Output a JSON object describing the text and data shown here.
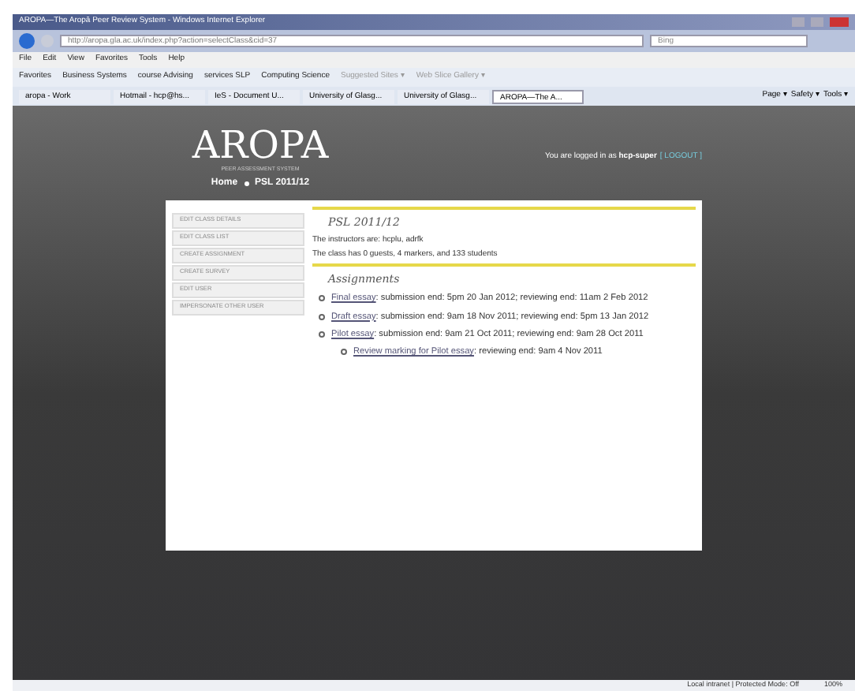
{
  "window": {
    "title": "AROPA—The Aropā Peer Review System - Windows Internet Explorer"
  },
  "address_bar": {
    "url": "http://aropa.gla.ac.uk/index.php?action=selectClass&cid=37",
    "search_placeholder": "Bing"
  },
  "menu": [
    "File",
    "Edit",
    "View",
    "Favorites",
    "Tools",
    "Help"
  ],
  "favorites_bar": [
    "Favorites",
    "Business Systems",
    "course Advising",
    "services SLP",
    "Computing Science",
    "Suggested Sites ▾",
    "Web Slice Gallery ▾"
  ],
  "tabs": [
    {
      "label": "aropa - Work",
      "selected": false
    },
    {
      "label": "Hotmail - hcp@hs...",
      "selected": false
    },
    {
      "label": "IeS - Document U...",
      "selected": false
    },
    {
      "label": "University of Glasg...",
      "selected": false
    },
    {
      "label": "University of Glasg...",
      "selected": false
    },
    {
      "label": "AROPA—The A...",
      "selected": true
    }
  ],
  "command_bar": [
    "Page ▾",
    "Safety ▾",
    "Tools ▾"
  ],
  "page": {
    "logo": "AROPA",
    "tagline": "PEER ASSESSMENT SYSTEM",
    "breadcrumb": [
      "Home",
      "PSL 2011/12"
    ],
    "login_text": "You are logged in as **hcp-super**",
    "logout": "[ LOGOUT ]",
    "side_menu": [
      "EDIT CLASS DETAILS",
      "EDIT CLASS LIST",
      "CREATE ASSIGNMENT",
      "CREATE SURVEY",
      "EDIT USER",
      "IMPERSONATE OTHER USER"
    ],
    "class_title": "PSL 2011/12",
    "info": [
      "The instructors are: hcplu, adrfk",
      "The class has 0 guests, 4 markers, and 133 students"
    ],
    "assignments_heading": "Assignments",
    "assignments": [
      {
        "link": "Final essay",
        "text": ": submission end: 5pm 20 Jan 2012; reviewing end: 11am 2 Feb 2012"
      },
      {
        "link": "Draft essay",
        "text": ": submission end: 9am 18 Nov 2011; reviewing end: 5pm 13 Jan 2012"
      },
      {
        "link": "Pilot essay",
        "text": ": submission end: 9am 21 Oct 2011; reviewing end: 9am 28 Oct 2011",
        "children": [
          {
            "link": "Review marking for Pilot essay",
            "text": ": reviewing end: 9am 4 Nov 2011"
          }
        ]
      }
    ]
  },
  "status_bar": {
    "zone": "Local intranet | Protected Mode: Off",
    "zoom": "100%"
  }
}
